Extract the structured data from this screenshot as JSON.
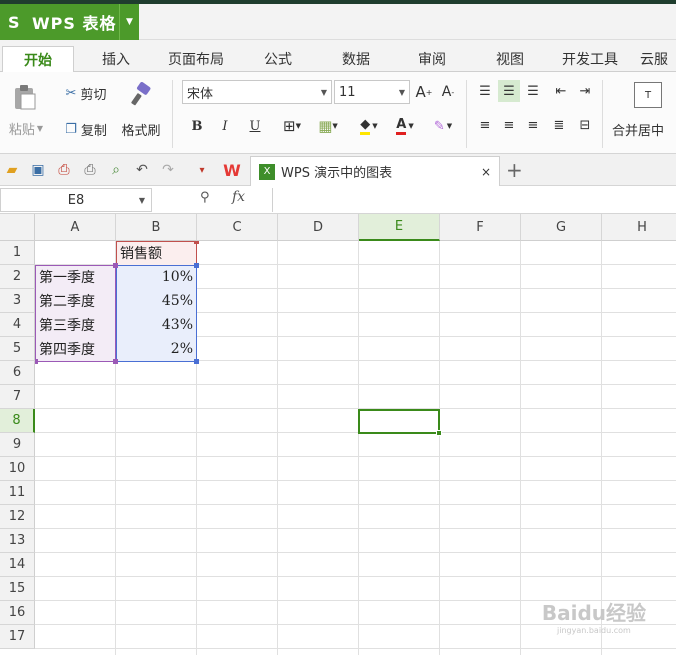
{
  "app": {
    "title": "WPS 表格",
    "logo": "S"
  },
  "menu": {
    "tabs": [
      "开始",
      "插入",
      "页面布局",
      "公式",
      "数据",
      "审阅",
      "视图",
      "开发工具",
      "云服"
    ]
  },
  "ribbon": {
    "paste": "粘贴",
    "cut": "剪切",
    "copy": "复制",
    "format_painter": "格式刷",
    "font_name": "宋体",
    "font_size": "11",
    "merge_center": "合并居中",
    "bold": "B",
    "italic": "I",
    "underline": "U",
    "font_color_letter": "A",
    "grow_font": "A",
    "shrink_font": "A"
  },
  "document": {
    "tab_title": "WPS 演示中的图表",
    "close": "×",
    "new_tab": "+"
  },
  "formula_bar": {
    "name_box": "E8",
    "fx": "fx"
  },
  "grid": {
    "columns": [
      "A",
      "B",
      "C",
      "D",
      "E",
      "F",
      "G",
      "H"
    ],
    "rows": [
      "1",
      "2",
      "3",
      "4",
      "5",
      "6",
      "7",
      "8",
      "9",
      "10",
      "11",
      "12",
      "13",
      "14",
      "15",
      "16",
      "17"
    ],
    "header_b": "销售额",
    "labels": [
      "第一季度",
      "第二季度",
      "第三季度",
      "第四季度"
    ],
    "values": [
      "10%",
      "45%",
      "43%",
      "2%"
    ],
    "selected_column": "E",
    "selected_row": "8"
  },
  "colors": {
    "accent": "#3a8a1a",
    "brand": "#4c9a2a"
  },
  "watermark": {
    "text": "Baidu经验",
    "sub": "jingyan.baidu.com"
  }
}
